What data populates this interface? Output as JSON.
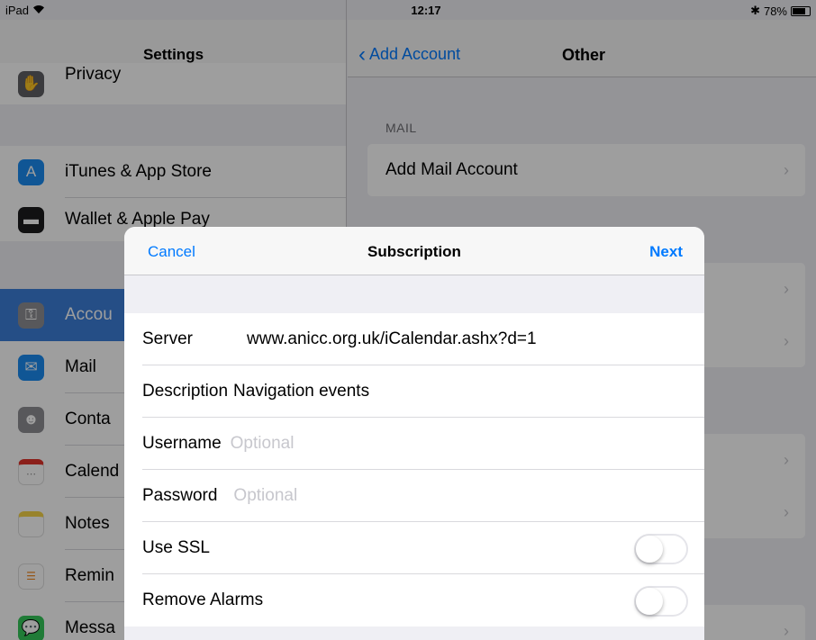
{
  "status_bar": {
    "device": "iPad",
    "time": "12:17",
    "battery": "78%"
  },
  "left_pane": {
    "title": "Settings",
    "items": [
      {
        "label": "Privacy",
        "icon": "hand-icon",
        "color": "#5f5f65"
      },
      {
        "label": "iTunes & App Store",
        "icon": "app-store-icon",
        "color": "#1a8cf0"
      },
      {
        "label": "Wallet & Apple Pay",
        "icon": "wallet-icon",
        "color": "#1c1c1e"
      },
      {
        "label": "Accou",
        "icon": "key-icon",
        "color": "#8e8e93"
      },
      {
        "label": "Mail",
        "icon": "mail-icon",
        "color": "#1a8cf0"
      },
      {
        "label": "Conta",
        "icon": "contacts-icon",
        "color": "#8e8e93"
      },
      {
        "label": "Calend",
        "icon": "calendar-icon",
        "color": "#ffffff"
      },
      {
        "label": "Notes",
        "icon": "notes-icon",
        "color": "#f6d348"
      },
      {
        "label": "Remin",
        "icon": "reminders-icon",
        "color": "#ffffff"
      },
      {
        "label": "Messa",
        "icon": "messages-icon",
        "color": "#34c759"
      }
    ]
  },
  "right_pane": {
    "back_label": "Add Account",
    "title": "Other",
    "mail_section_header": "MAIL",
    "mail_row": "Add Mail Account"
  },
  "modal": {
    "cancel_label": "Cancel",
    "title": "Subscription",
    "next_label": "Next",
    "fields": {
      "server_label": "Server",
      "server_value": "www.anicc.org.uk/iCalendar.ashx?d=1",
      "description_label": "Description",
      "description_value": "Navigation events",
      "username_label": "Username",
      "username_placeholder": "Optional",
      "password_label": "Password",
      "password_placeholder": "Optional",
      "use_ssl_label": "Use SSL",
      "use_ssl_on": false,
      "remove_alarms_label": "Remove Alarms",
      "remove_alarms_on": false
    }
  },
  "colors": {
    "accent": "#007aff",
    "selected_row": "#3c7ed8"
  }
}
